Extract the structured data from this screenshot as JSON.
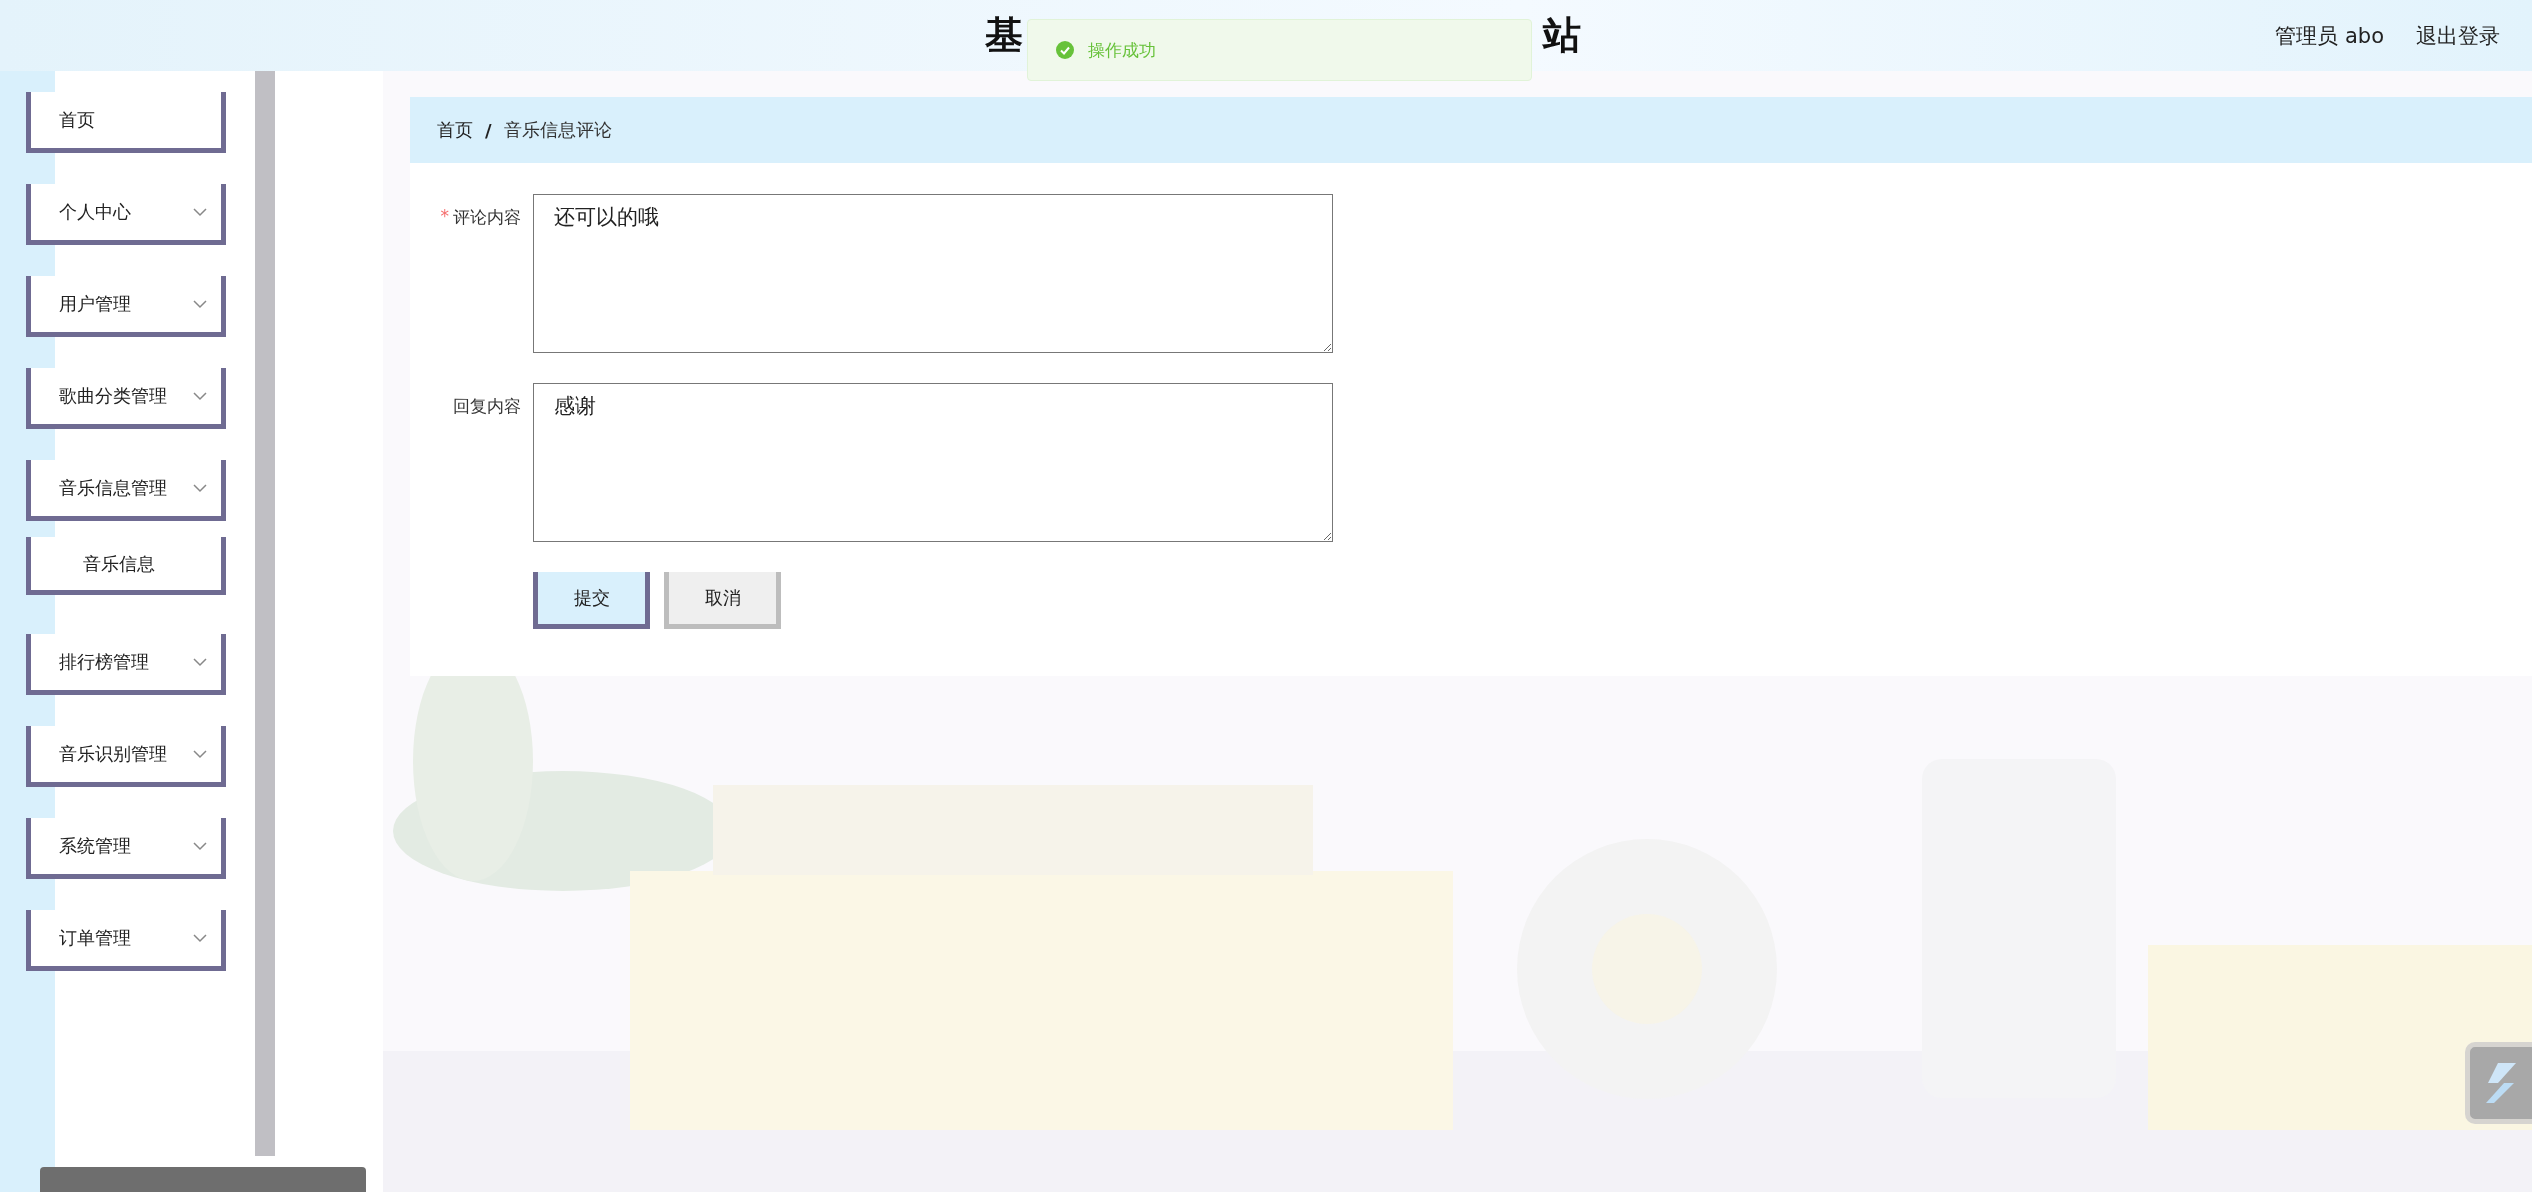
{
  "header": {
    "title_fragments": [
      "基",
      "站"
    ],
    "user": "管理员 abo",
    "logout": "退出登录"
  },
  "toast": {
    "kind": "success",
    "message": "操作成功"
  },
  "sidebar": {
    "items": [
      {
        "label": "首页",
        "kind": "link"
      },
      {
        "label": "个人中心",
        "kind": "menu"
      },
      {
        "label": "用户管理",
        "kind": "menu"
      },
      {
        "label": "歌曲分类管理",
        "kind": "menu"
      },
      {
        "label": "音乐信息管理",
        "kind": "menu",
        "children": [
          {
            "label": "音乐信息"
          }
        ]
      },
      {
        "label": "排行榜管理",
        "kind": "menu"
      },
      {
        "label": "音乐识别管理",
        "kind": "menu"
      },
      {
        "label": "系统管理",
        "kind": "menu"
      },
      {
        "label": "订单管理",
        "kind": "menu"
      }
    ]
  },
  "breadcrumb": {
    "items": [
      "首页",
      "音乐信息评论"
    ],
    "separator": "/"
  },
  "form": {
    "fields": [
      {
        "label": "评论内容",
        "required_mark": "*",
        "value": "还可以的哦"
      },
      {
        "label": "回复内容",
        "value": "感谢"
      }
    ],
    "buttons": [
      {
        "label": "提交",
        "kind": "primary"
      },
      {
        "label": "取消",
        "kind": "default"
      }
    ]
  }
}
